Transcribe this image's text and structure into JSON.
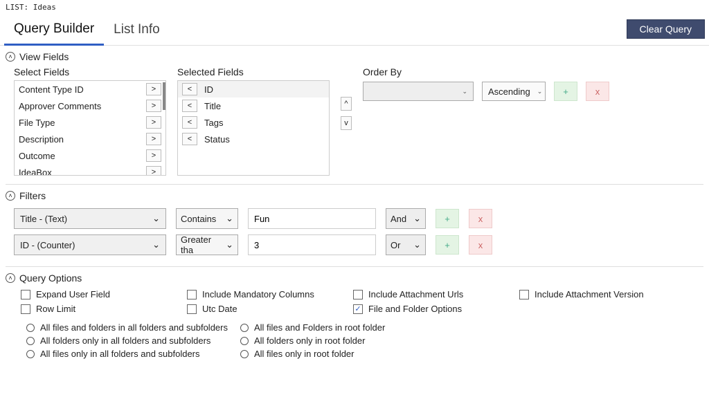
{
  "breadcrumb_prefix": "LIST:",
  "breadcrumb_value": "Ideas",
  "tabs": {
    "builder": "Query Builder",
    "info": "List Info"
  },
  "clear_button": "Clear Query",
  "sections": {
    "view_fields": "View Fields",
    "filters": "Filters",
    "query_options": "Query Options"
  },
  "labels": {
    "select_fields": "Select Fields",
    "selected_fields": "Selected Fields",
    "order_by": "Order By"
  },
  "available_fields": [
    "Content Type ID",
    "Approver Comments",
    "File Type",
    "Description",
    "Outcome",
    "IdeaBox"
  ],
  "selected_fields": [
    "ID",
    "Title",
    "Tags",
    "Status"
  ],
  "order_by": {
    "field": "",
    "direction": "Ascending"
  },
  "filters": [
    {
      "field": "Title - (Text)",
      "op": "Contains",
      "value": "Fun",
      "conj": "And"
    },
    {
      "field": "ID - (Counter)",
      "op": "Greater tha",
      "value": "3",
      "conj": "Or"
    }
  ],
  "query_options": {
    "expand_user_field": {
      "label": "Expand User Field",
      "checked": false
    },
    "include_mandatory": {
      "label": "Include Mandatory Columns",
      "checked": false
    },
    "include_attach_urls": {
      "label": "Include Attachment Urls",
      "checked": false
    },
    "include_attach_version": {
      "label": "Include Attachment Version",
      "checked": false
    },
    "row_limit": {
      "label": "Row Limit",
      "checked": false
    },
    "utc_date": {
      "label": "Utc Date",
      "checked": false
    },
    "file_folder": {
      "label": "File and Folder Options",
      "checked": true
    }
  },
  "file_folder_options": {
    "left": [
      "All files and folders in all folders and subfolders",
      "All folders only in all folders and subfolders",
      "All files only in all folders and subfolders"
    ],
    "right": [
      "All files and Folders in root folder",
      "All folders only in root folder",
      "All files only in root folder"
    ]
  },
  "glyphs": {
    "gt": ">",
    "lt": "<",
    "up": "^",
    "down": "v",
    "plus": "+",
    "x": "x",
    "caret": "⌄"
  }
}
